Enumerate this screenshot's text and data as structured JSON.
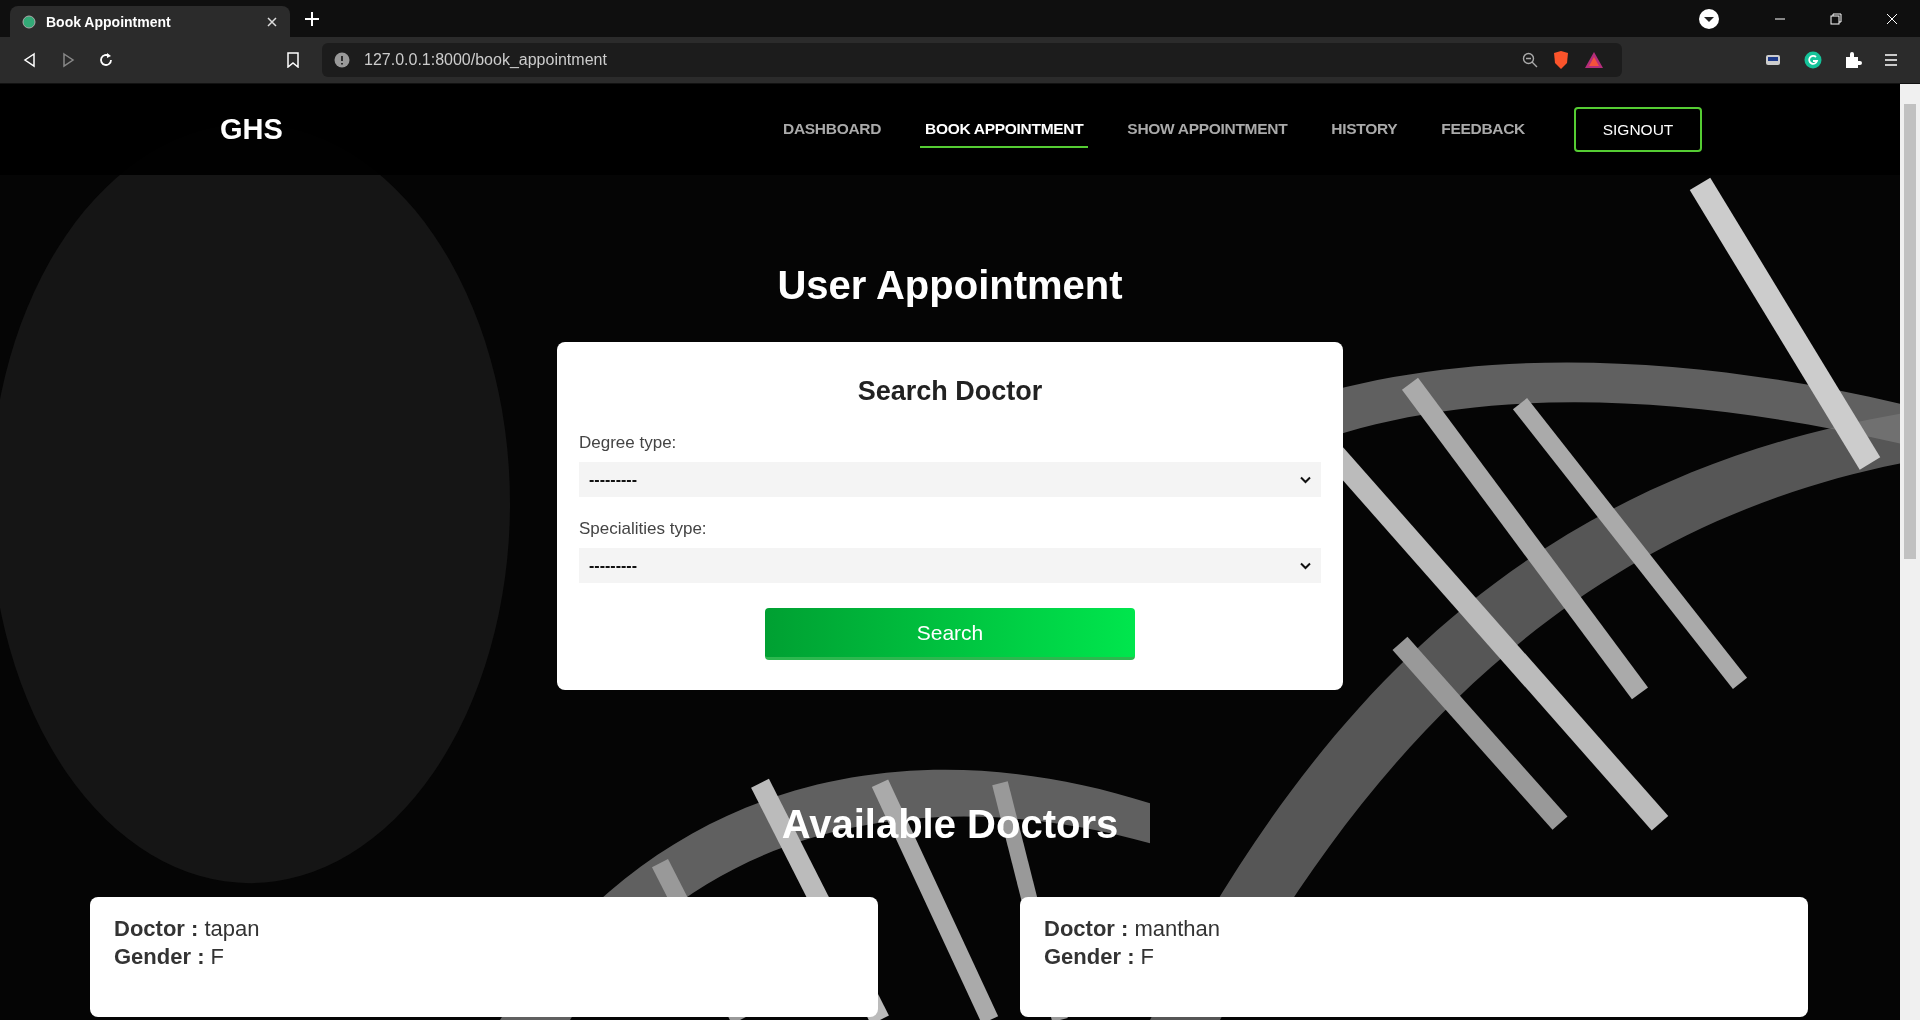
{
  "browser": {
    "tab_title": "Book Appointment",
    "url": "127.0.0.1:8000/book_appointment"
  },
  "nav": {
    "brand": "GHS",
    "links": [
      {
        "label": "DASHBOARD",
        "selected": false
      },
      {
        "label": "BOOK APPOINTMENT",
        "selected": true
      },
      {
        "label": "SHOW APPOINTMENT",
        "selected": false
      },
      {
        "label": "HISTORY",
        "selected": false
      },
      {
        "label": "FEEDBACK",
        "selected": false
      }
    ],
    "signout": "SIGNOUT"
  },
  "title": "User Appointment",
  "search": {
    "heading": "Search Doctor",
    "fields": [
      {
        "label": "Degree type:",
        "value": "---------"
      },
      {
        "label": "Specialities type:",
        "value": "---------"
      }
    ],
    "button": "Search"
  },
  "doctors_heading": "Available Doctors",
  "doctors": [
    {
      "rows": [
        {
          "label": "Doctor :",
          "value": "tapan"
        },
        {
          "label": "Gender :",
          "value": "F"
        }
      ]
    },
    {
      "rows": [
        {
          "label": "Doctor :",
          "value": "manthan"
        },
        {
          "label": "Gender :",
          "value": "F"
        }
      ]
    }
  ]
}
